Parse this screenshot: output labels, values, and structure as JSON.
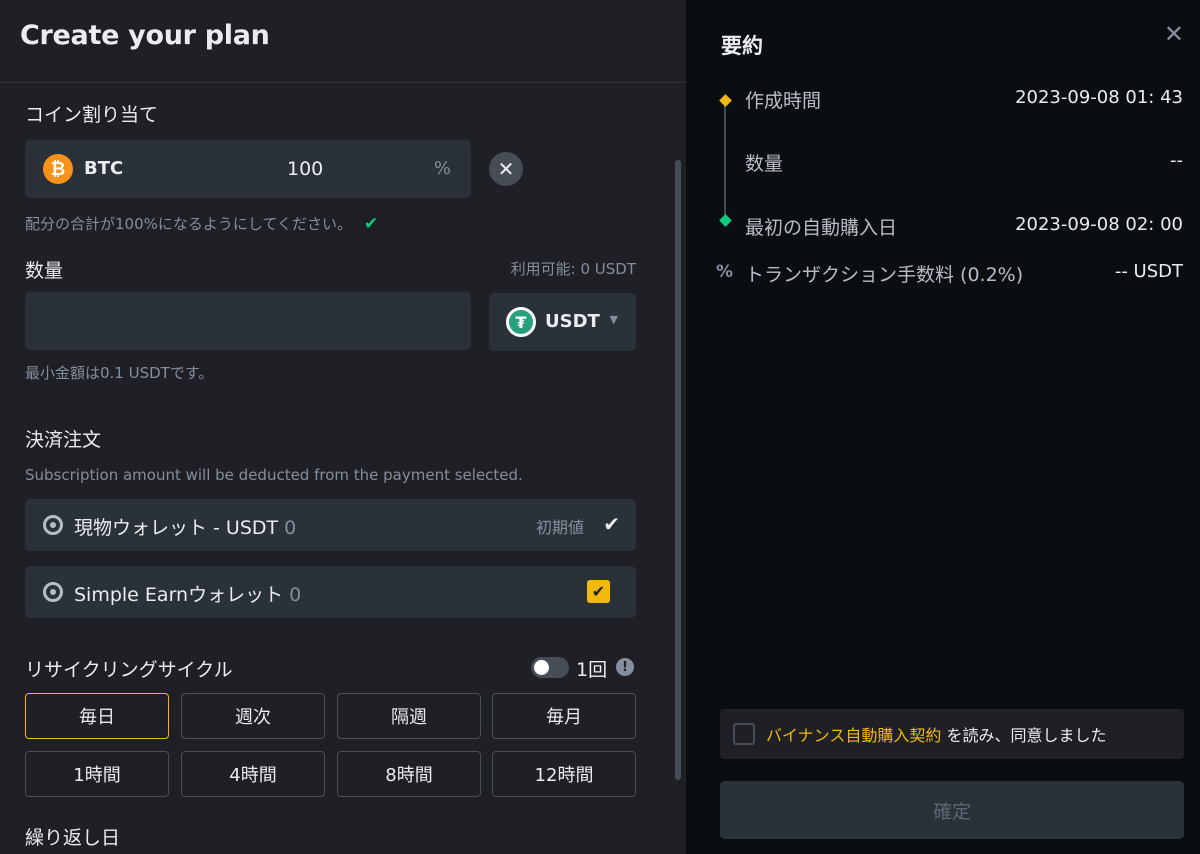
{
  "header": {
    "title": "Create your plan"
  },
  "allocation": {
    "heading": "コイン割り当て",
    "coin": "BTC",
    "percent": "100",
    "unit": "%",
    "hint": "配分の合計が100%になるようにしてください。"
  },
  "amount": {
    "heading": "数量",
    "available": "利用可能: 0 USDT",
    "value": "",
    "currency": "USDT",
    "min_hint": "最小金額は0.1 USDTです。"
  },
  "payment": {
    "heading": "決済注文",
    "description": "Subscription amount will be deducted from the payment selected.",
    "wallets": [
      {
        "name": "現物ウォレット - USDT",
        "balance": "0",
        "tag": "初期値"
      },
      {
        "name": "Simple Earnウォレット",
        "balance": "0"
      }
    ]
  },
  "recurring": {
    "heading": "リサイクリングサイクル",
    "once_label": "1回",
    "options_row1": [
      "毎日",
      "週次",
      "隔週",
      "毎月"
    ],
    "options_row2": [
      "1時間",
      "4時間",
      "8時間",
      "12時間"
    ],
    "selected": "毎日"
  },
  "repeat_day": {
    "heading": "繰り返し日"
  },
  "summary": {
    "title": "要約",
    "created_label": "作成時間",
    "created_value": "2023-09-08 01: 43",
    "quantity_label": "数量",
    "quantity_value": "--",
    "first_buy_label": "最初の自動購入日",
    "first_buy_value": "2023-09-08 02: 00",
    "fee_label": "トランザクション手数料 (0.2%)",
    "fee_value": "-- USDT",
    "agreement_link": "バイナンス自動購入契約",
    "agreement_text": " を読み、同意しました",
    "confirm_label": "確定"
  },
  "colors": {
    "accent": "#f0b90b",
    "success": "#0ecb81",
    "btc": "#f7931a",
    "usdt": "#26a17b"
  },
  "icons": [
    "btc-icon",
    "close-icon",
    "check-icon",
    "usdt-icon",
    "caret-down-icon",
    "wallet-icon",
    "info-icon",
    "percent-icon"
  ]
}
